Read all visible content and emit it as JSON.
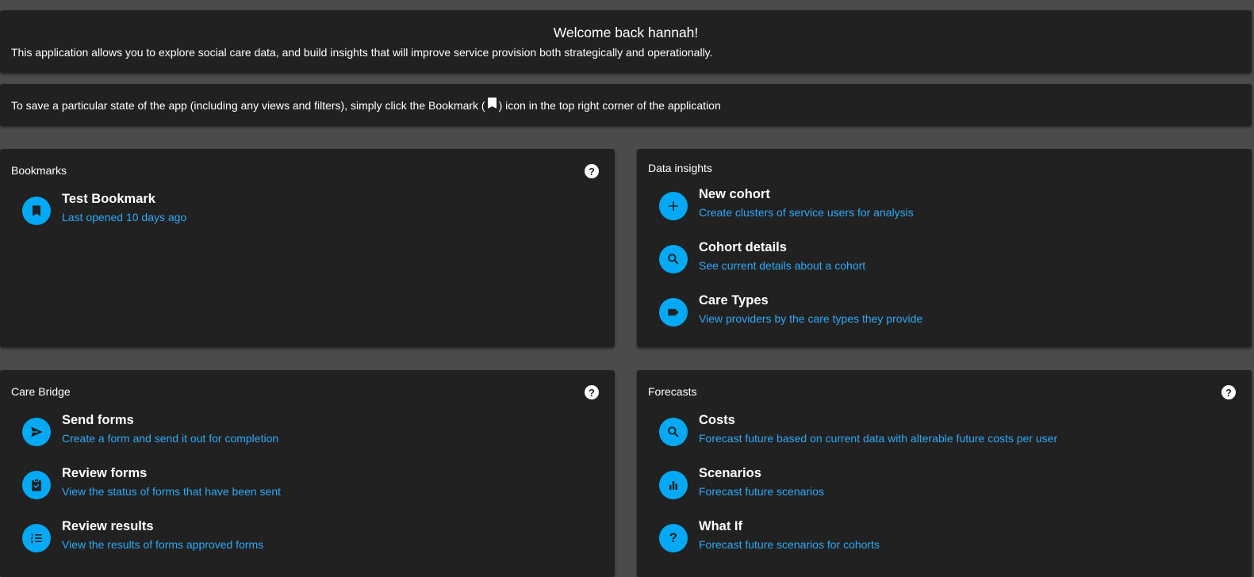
{
  "welcome": {
    "title": "Welcome back hannah!",
    "description": "This application allows you to explore social care data, and build insights that will improve service provision both strategically and operationally."
  },
  "tip": {
    "before": "To save a particular state of the app (including any views and filters), simply click the Bookmark (",
    "after": ") icon in the top right corner of the application"
  },
  "bookmarks": {
    "title": "Bookmarks",
    "help": "?",
    "items": [
      {
        "label": "Test Bookmark",
        "sub": "Last opened 10 days ago",
        "icon": "bookmark-icon"
      }
    ]
  },
  "insights": {
    "title": "Data insights",
    "items": [
      {
        "label": "New cohort",
        "sub": "Create clusters of service users for analysis",
        "icon": "plus-icon"
      },
      {
        "label": "Cohort details",
        "sub": "See current details about a cohort",
        "icon": "search-icon"
      },
      {
        "label": "Care Types",
        "sub": "View providers by the care types they provide",
        "icon": "label-icon"
      }
    ]
  },
  "carebridge": {
    "title": "Care Bridge",
    "help": "?",
    "items": [
      {
        "label": "Send forms",
        "sub": "Create a form and send it out for completion",
        "icon": "send-icon"
      },
      {
        "label": "Review forms",
        "sub": "View the status of forms that have been sent",
        "icon": "clipboard-check-icon"
      },
      {
        "label": "Review results",
        "sub": "View the results of forms approved forms",
        "icon": "list-numbered-icon"
      }
    ]
  },
  "forecasts": {
    "title": "Forecasts",
    "help": "?",
    "items": [
      {
        "label": "Costs",
        "sub": "Forecast future based on current data with alterable future costs per user",
        "icon": "search-icon"
      },
      {
        "label": "Scenarios",
        "sub": "Forecast future scenarios",
        "icon": "bar-chart-icon"
      },
      {
        "label": "What If",
        "sub": "Forecast future scenarios for cohorts",
        "icon": "question-icon",
        "glyph": "?"
      }
    ]
  },
  "colors": {
    "background": "#4b4b4b",
    "card": "#212121",
    "accent": "#03a9f4",
    "link": "#2ea8f5"
  }
}
